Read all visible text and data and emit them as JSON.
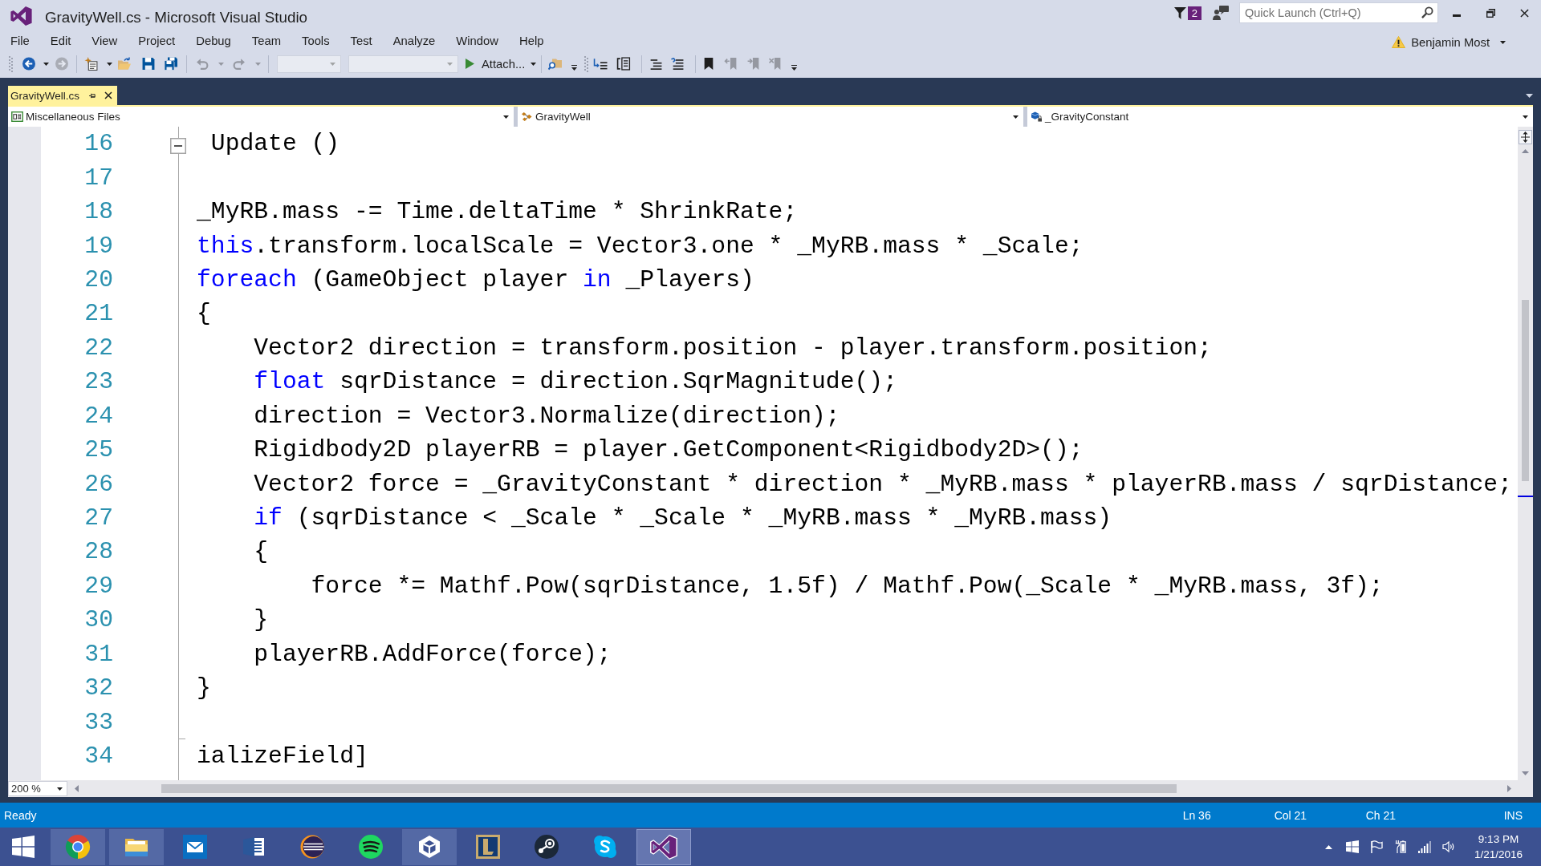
{
  "window": {
    "title": "GravityWell.cs - Microsoft Visual Studio"
  },
  "title_bar": {
    "notification_count": "2",
    "quick_launch": {
      "placeholder": "Quick Launch (Ctrl+Q)"
    }
  },
  "menu": [
    "File",
    "Edit",
    "View",
    "Project",
    "Debug",
    "Team",
    "Tools",
    "Test",
    "Analyze",
    "Window",
    "Help"
  ],
  "account": {
    "name": "Benjamin Most",
    "warning": true
  },
  "toolbar": {
    "back": {
      "disabled": false
    },
    "forward": {
      "disabled": true
    },
    "new_project": {
      "disabled": false
    },
    "open": {
      "disabled": false
    },
    "save": {
      "disabled": false
    },
    "save_all": {
      "disabled": false
    },
    "undo": {
      "disabled": true
    },
    "redo": {
      "disabled": true
    },
    "configuration": {
      "disabled": true
    },
    "platform": {
      "disabled": true
    },
    "attach": {
      "label": "Attach..."
    },
    "bookmark": {
      "disabled": false
    },
    "previous_bookmark": {
      "disabled": true
    },
    "next_bookmark": {
      "disabled": true
    },
    "clear_bookmarks": {
      "disabled": true
    }
  },
  "document_tabs": [
    {
      "label": "GravityWell.cs",
      "selected": true
    }
  ],
  "navigation_bar": [
    "Miscellaneous Files",
    "GravityWell",
    "_GravityConstant"
  ],
  "editor": {
    "lines": [
      {
        "number": "16",
        "collapsible": true,
        "expanded": true,
        "tokens": [
          {
            "kind": "plain",
            "text": " Update ()"
          }
        ]
      },
      {
        "number": "17"
      },
      {
        "number": "18",
        "tokens": [
          {
            "kind": "plain",
            "text": "_MyRB.mass -= Time.deltaTime * ShrinkRate;"
          }
        ]
      },
      {
        "number": "19",
        "tokens": [
          {
            "kind": "keyword",
            "text": "this"
          },
          {
            "kind": "plain",
            "text": ".transform.localScale = Vector3.one * _MyRB.mass * _Scale;"
          }
        ]
      },
      {
        "number": "20",
        "tokens": [
          {
            "kind": "keyword",
            "text": "foreach"
          },
          {
            "kind": "plain",
            "text": " (GameObject player "
          },
          {
            "kind": "keyword",
            "text": "in"
          },
          {
            "kind": "plain",
            "text": " _Players)"
          }
        ]
      },
      {
        "number": "21",
        "tokens": [
          {
            "kind": "plain",
            "text": "{"
          }
        ]
      },
      {
        "number": "22",
        "tokens": [
          {
            "kind": "plain",
            "text": "    Vector2 direction = transform.position - player.transform.position;"
          }
        ]
      },
      {
        "number": "23",
        "tokens": [
          {
            "kind": "keyword",
            "text": "    float"
          },
          {
            "kind": "plain",
            "text": " sqrDistance = direction.SqrMagnitude();"
          }
        ]
      },
      {
        "number": "24",
        "tokens": [
          {
            "kind": "plain",
            "text": "    direction = Vector3.Normalize(direction);"
          }
        ]
      },
      {
        "number": "25",
        "tokens": [
          {
            "kind": "plain",
            "text": "    Rigidbody2D playerRB = player.GetComponent<Rigidbody2D>();"
          }
        ]
      },
      {
        "number": "26",
        "tokens": [
          {
            "kind": "plain",
            "text": "    Vector2 force = _GravityConstant * direction * _MyRB.mass * playerRB.mass / sqrDistance;"
          }
        ]
      },
      {
        "number": "27",
        "tokens": [
          {
            "kind": "keyword",
            "text": "    if"
          },
          {
            "kind": "plain",
            "text": " (sqrDistance < _Scale * _Scale * _MyRB.mass * _MyRB.mass)"
          }
        ]
      },
      {
        "number": "28",
        "tokens": [
          {
            "kind": "plain",
            "text": "    {"
          }
        ]
      },
      {
        "number": "29",
        "tokens": [
          {
            "kind": "plain",
            "text": "        force *= Mathf.Pow(sqrDistance, 1.5f) / Mathf.Pow(_Scale * _MyRB.mass, 3f);"
          }
        ]
      },
      {
        "number": "30",
        "tokens": [
          {
            "kind": "plain",
            "text": "    }"
          }
        ]
      },
      {
        "number": "31",
        "tokens": [
          {
            "kind": "plain",
            "text": "    playerRB.AddForce(force);"
          }
        ]
      },
      {
        "number": "32",
        "tokens": [
          {
            "kind": "plain",
            "text": "}"
          }
        ]
      },
      {
        "number": "33",
        "region_end": true
      },
      {
        "number": "34",
        "tokens": [
          {
            "kind": "plain",
            "text": "ializeField]"
          }
        ]
      }
    ],
    "zoom": "200 %"
  },
  "status_bar": {
    "message": "Ready",
    "line": "Ln 36",
    "column": "Col 21",
    "character": "Ch 21",
    "mode": "INS"
  },
  "taskbar": {
    "apps": [
      {
        "running": true,
        "selected": false
      },
      {
        "running": true,
        "selected": false
      },
      {
        "running": false,
        "selected": false
      },
      {
        "running": false,
        "selected": false
      },
      {
        "running": false,
        "selected": false
      },
      {
        "running": false,
        "selected": false
      },
      {
        "running": true,
        "selected": false
      },
      {
        "running": false,
        "selected": false
      },
      {
        "running": false,
        "selected": false
      },
      {
        "running": false,
        "selected": false
      },
      {
        "running": true,
        "selected": true
      }
    ],
    "clock": {
      "time": "9:13 PM",
      "date": "1/21/2016"
    }
  }
}
